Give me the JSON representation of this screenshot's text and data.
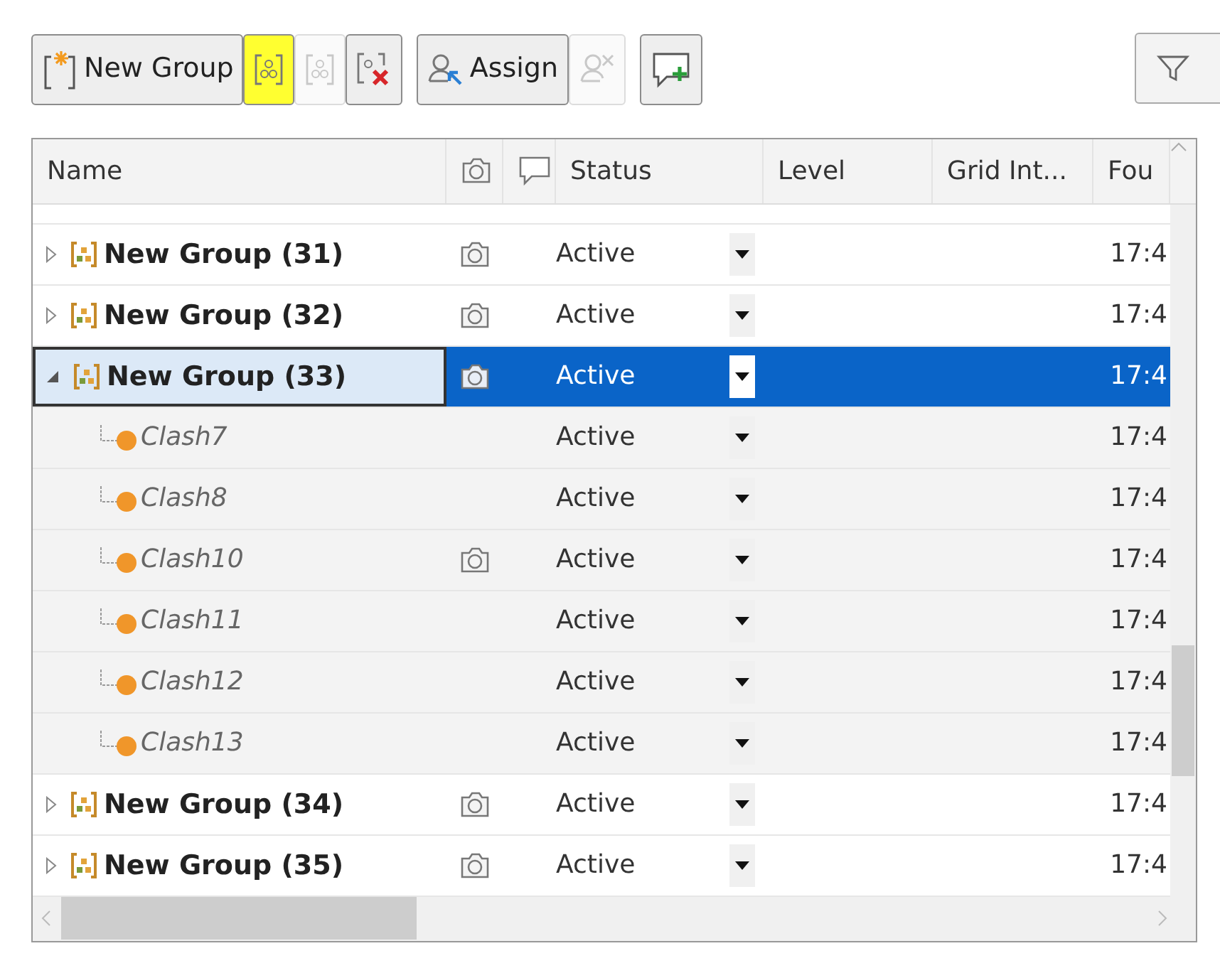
{
  "toolbar": [
    {
      "buttons": [
        {
          "kind": "new-group",
          "label": "New Group",
          "disabled": false,
          "highlighted": false
        },
        {
          "kind": "group",
          "disabled": false,
          "highlighted": true
        },
        {
          "kind": "ungroup",
          "disabled": true,
          "highlighted": false
        },
        {
          "kind": "remove",
          "disabled": false,
          "highlighted": false
        }
      ]
    },
    {
      "buttons": [
        {
          "kind": "assign",
          "label": "Assign",
          "disabled": false,
          "highlighted": false
        },
        {
          "kind": "unassign",
          "disabled": true,
          "highlighted": false
        }
      ]
    },
    {
      "buttons": [
        {
          "kind": "comment",
          "disabled": false,
          "highlighted": false
        }
      ]
    }
  ],
  "table": {
    "columns": [
      {
        "kind": "text",
        "label": "Name"
      },
      {
        "kind": "camera"
      },
      {
        "kind": "comment"
      },
      {
        "kind": "text",
        "label": "Status"
      },
      {
        "kind": "text",
        "label": "Level"
      },
      {
        "kind": "text",
        "label": "Grid Int..."
      },
      {
        "kind": "text",
        "label": "Fou"
      }
    ],
    "rows": [
      {
        "kind": "group",
        "name": "New Group (31)",
        "expanded": false,
        "selected": false,
        "has_image": true,
        "status": "Active",
        "time": "17:4"
      },
      {
        "kind": "group",
        "name": "New Group (32)",
        "expanded": false,
        "selected": false,
        "has_image": true,
        "status": "Active",
        "time": "17:4"
      },
      {
        "kind": "group",
        "name": "New Group (33)",
        "expanded": true,
        "selected": true,
        "has_image": true,
        "status": "Active",
        "time": "17:4",
        "children": [
          {
            "kind": "clash",
            "name": "Clash7",
            "selected": false,
            "has_image": false,
            "status": "Active",
            "time": "17:4"
          },
          {
            "kind": "clash",
            "name": "Clash8",
            "selected": false,
            "has_image": false,
            "status": "Active",
            "time": "17:4"
          },
          {
            "kind": "clash",
            "name": "Clash10",
            "selected": false,
            "has_image": true,
            "status": "Active",
            "time": "17:4"
          },
          {
            "kind": "clash",
            "name": "Clash11",
            "selected": false,
            "has_image": false,
            "status": "Active",
            "time": "17:4"
          },
          {
            "kind": "clash",
            "name": "Clash12",
            "selected": false,
            "has_image": false,
            "status": "Active",
            "time": "17:4"
          },
          {
            "kind": "clash",
            "name": "Clash13",
            "selected": false,
            "has_image": false,
            "status": "Active",
            "time": "17:4"
          }
        ]
      },
      {
        "kind": "group",
        "name": "New Group (34)",
        "expanded": false,
        "selected": false,
        "has_image": true,
        "status": "Active",
        "time": "17:4"
      },
      {
        "kind": "group",
        "name": "New Group (35)",
        "expanded": false,
        "selected": false,
        "has_image": true,
        "status": "Active",
        "time": "17:4"
      }
    ]
  }
}
